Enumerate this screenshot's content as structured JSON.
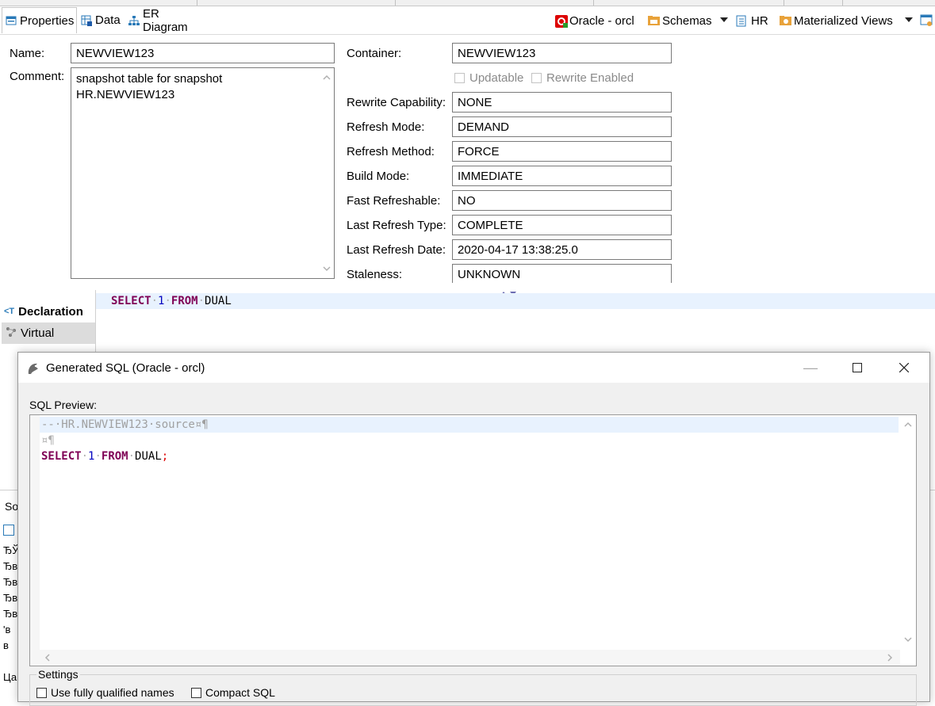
{
  "inner_tabs": [
    {
      "label": "Properties",
      "icon": "properties-icon"
    },
    {
      "label": "Data",
      "icon": "data-grid-icon"
    },
    {
      "label": "ER Diagram",
      "icon": "er-diagram-icon"
    }
  ],
  "breadcrumb": {
    "connection": "Oracle - orcl",
    "schemas": "Schemas",
    "schema": "HR",
    "folder": "Materialized Views"
  },
  "props": {
    "name_label": "Name:",
    "name_value": "NEWVIEW123",
    "comment_label": "Comment:",
    "comment_value": "snapshot table for snapshot HR.NEWVIEW123",
    "container_label": "Container:",
    "container_value": "NEWVIEW123",
    "updatable_label": "Updatable",
    "rewrite_enabled_label": "Rewrite Enabled",
    "rows": [
      {
        "label": "Rewrite Capability:",
        "value": "NONE"
      },
      {
        "label": "Refresh Mode:",
        "value": "DEMAND"
      },
      {
        "label": "Refresh Method:",
        "value": "FORCE"
      },
      {
        "label": "Build Mode:",
        "value": "IMMEDIATE"
      },
      {
        "label": "Fast Refreshable:",
        "value": "NO"
      },
      {
        "label": "Last Refresh Type:",
        "value": "COMPLETE"
      },
      {
        "label": "Last Refresh Date:",
        "value": "2020-04-17 13:38:25.0"
      },
      {
        "label": "Staleness:",
        "value": "UNKNOWN"
      }
    ]
  },
  "side_tabs": {
    "declaration": "Declaration",
    "virtual": "Virtual"
  },
  "editor_sql": {
    "kw1": "SELECT",
    "num": "1",
    "kw2": "FROM",
    "table": "DUAL"
  },
  "bg_fragments": {
    "so": "So",
    "lines": [
      "ЂЎ",
      "Ђв",
      "Ђв",
      "Ђв",
      "Ђв",
      "'в в"
    ],
    "last": "Ца"
  },
  "dialog": {
    "title": "Generated SQL (Oracle - orcl)",
    "sql_preview_label": "SQL Preview:",
    "comment_line": "--·HR.NEWVIEW123·source¤¶",
    "blank_line": "¤¶",
    "sql_kw1": "SELECT",
    "sql_num": "1",
    "sql_kw2": "FROM",
    "sql_table": "DUAL",
    "sql_end": ";",
    "settings_label": "Settings",
    "opt_fqn": "Use fully qualified names",
    "opt_compact": "Compact SQL"
  },
  "colors": {
    "keyword": "#7f0055",
    "number": "#0000c0",
    "highlight_line": "#e8f2fe",
    "whitespace_marker": "#b0b0b0"
  }
}
